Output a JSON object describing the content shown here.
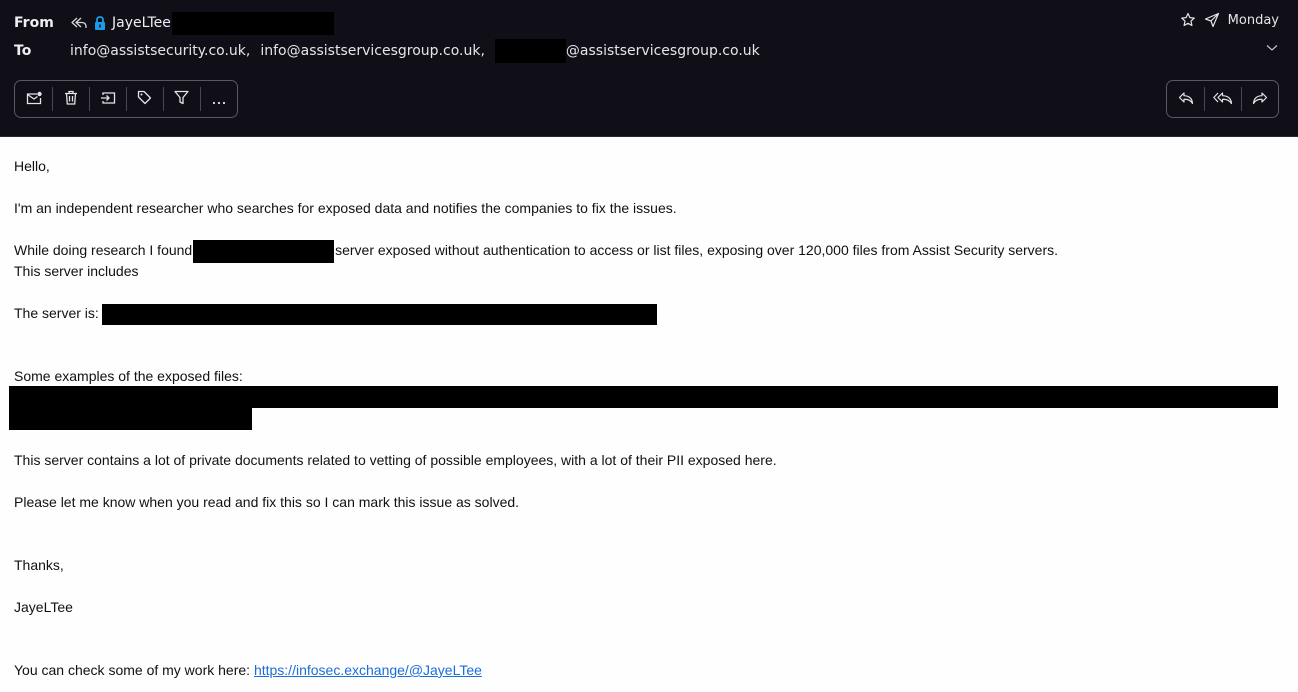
{
  "header": {
    "from_label": "From",
    "to_label": "To",
    "sender_name": "JayeLTee",
    "date": "Monday",
    "recipients": [
      "info@assistsecurity.co.uk,",
      "info@assistservicesgroup.co.uk,",
      "@assistservicesgroup.co.uk"
    ],
    "icons": {
      "reply_status": "replied-icon",
      "lock": "lock-icon",
      "star": "star-icon",
      "sent": "paper-plane-icon",
      "expand": "chevron-down-icon"
    },
    "lock_color": "#1e9be8"
  },
  "toolbar_left": [
    {
      "name": "mark-unread-button",
      "icon": "mail-unread-icon"
    },
    {
      "name": "delete-button",
      "icon": "trash-icon"
    },
    {
      "name": "move-button",
      "icon": "move-to-folder-icon"
    },
    {
      "name": "tag-button",
      "icon": "tag-icon"
    },
    {
      "name": "filter-button",
      "icon": "filter-icon"
    },
    {
      "name": "more-button",
      "icon": "more-horizontal-icon"
    }
  ],
  "toolbar_right": [
    {
      "name": "reply-button",
      "icon": "reply-icon"
    },
    {
      "name": "reply-all-button",
      "icon": "reply-all-icon"
    },
    {
      "name": "forward-button",
      "icon": "forward-icon"
    }
  ],
  "email": {
    "greeting": "Hello,",
    "intro": "I'm an independent researcher who searches for exposed data and notifies the companies to fix the issues.",
    "found_prefix": "While doing research I found ",
    "found_suffix": "server exposed without authentication to access or list files, exposing over 120,000 files from Assist Security servers.",
    "includes": "This server includes",
    "server_label": "The server is: ",
    "examples_label": "Some examples of the exposed files:",
    "pii_note": "This server contains a lot of private documents related to vetting of possible employees, with a lot of their PII exposed here.",
    "request": "Please let me know when you read and fix this so I can mark this issue as solved.",
    "closing": "Thanks,",
    "signature": "JayeLTee",
    "work_prefix": "You can check some of my work here: ",
    "work_link": "https://infosec.exchange/@JayeLTee"
  },
  "colors": {
    "header_bg": "#100e16",
    "body_bg": "#fefefe",
    "link": "#1a6ed8"
  }
}
